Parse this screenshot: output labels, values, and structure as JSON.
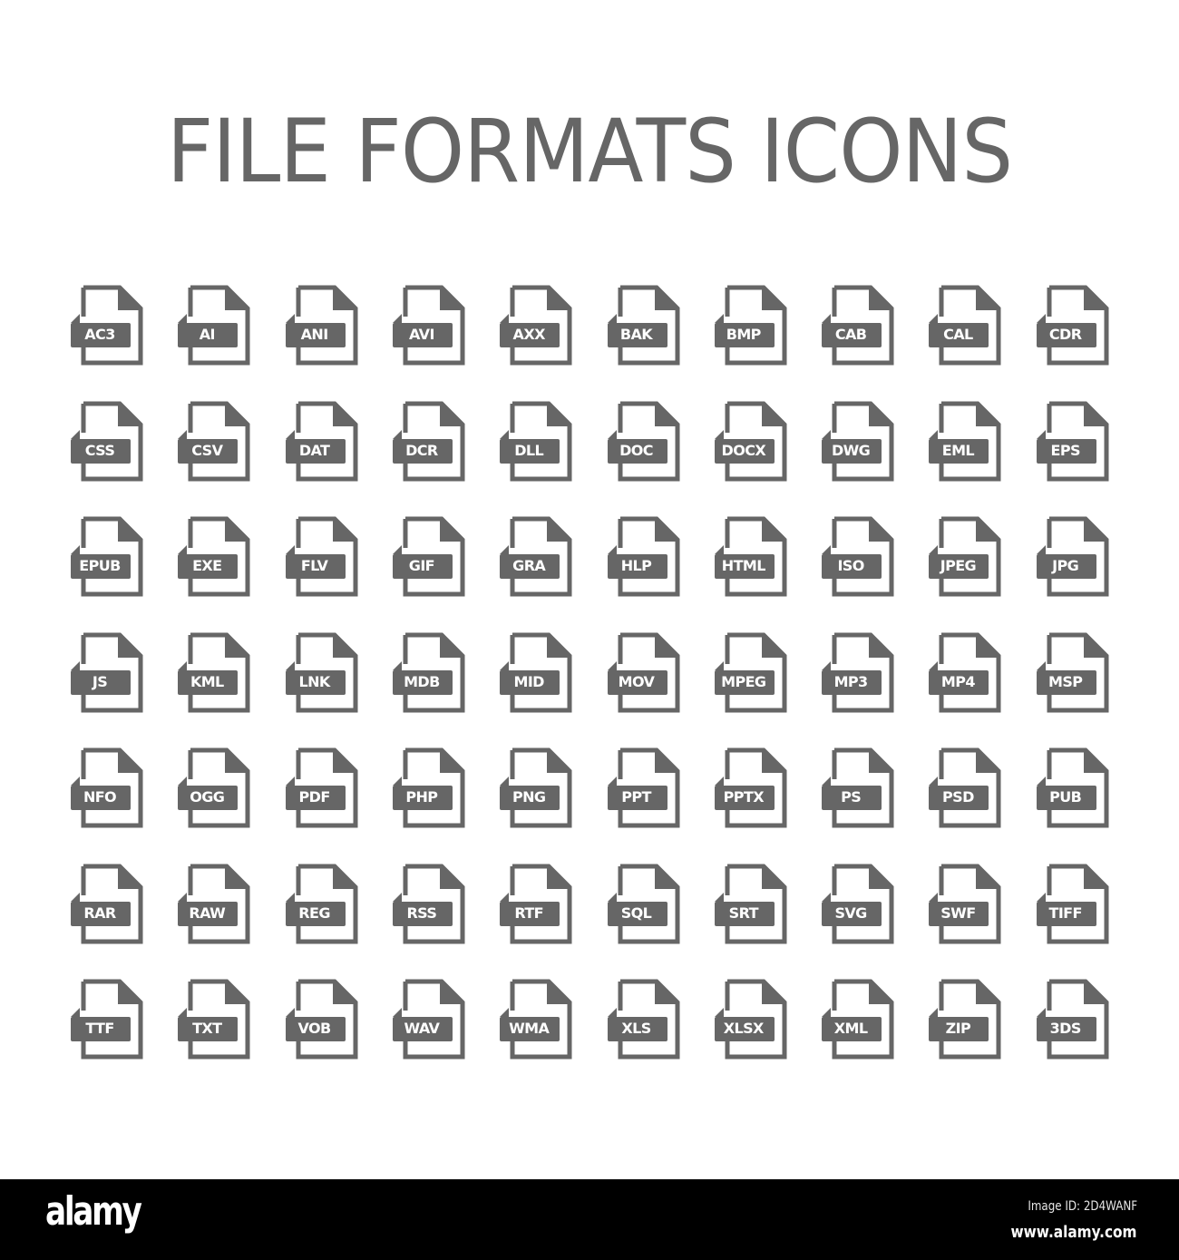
{
  "title": "FILE FORMATS ICONS",
  "icon_color": "#666666",
  "background_color": "#ffffff",
  "columns": 10,
  "icons": [
    "AC3",
    "AI",
    "ANI",
    "AVI",
    "AXX",
    "BAK",
    "BMP",
    "CAB",
    "CAL",
    "CDR",
    "CSS",
    "CSV",
    "DAT",
    "DCR",
    "DLL",
    "DOC",
    "DOCX",
    "DWG",
    "EML",
    "EPS",
    "EPUB",
    "EXE",
    "FLV",
    "GIF",
    "GRA",
    "HLP",
    "HTML",
    "ISO",
    "JPEG",
    "JPG",
    "JS",
    "KML",
    "LNK",
    "MDB",
    "MID",
    "MOV",
    "MPEG",
    "MP3",
    "MP4",
    "MSP",
    "NFO",
    "OGG",
    "PDF",
    "PHP",
    "PNG",
    "PPT",
    "PPTX",
    "PS",
    "PSD",
    "PUB",
    "RAR",
    "RAW",
    "REG",
    "RSS",
    "RTF",
    "SQL",
    "SRT",
    "SVG",
    "SWF",
    "TIFF",
    "TTF",
    "TXT",
    "VOB",
    "WAV",
    "WMA",
    "XLS",
    "XLSX",
    "XML",
    "ZIP",
    "3DS"
  ],
  "footer": {
    "logo": "alamy",
    "image_id": "Image ID: 2D4WANF",
    "url": "www.alamy.com"
  }
}
